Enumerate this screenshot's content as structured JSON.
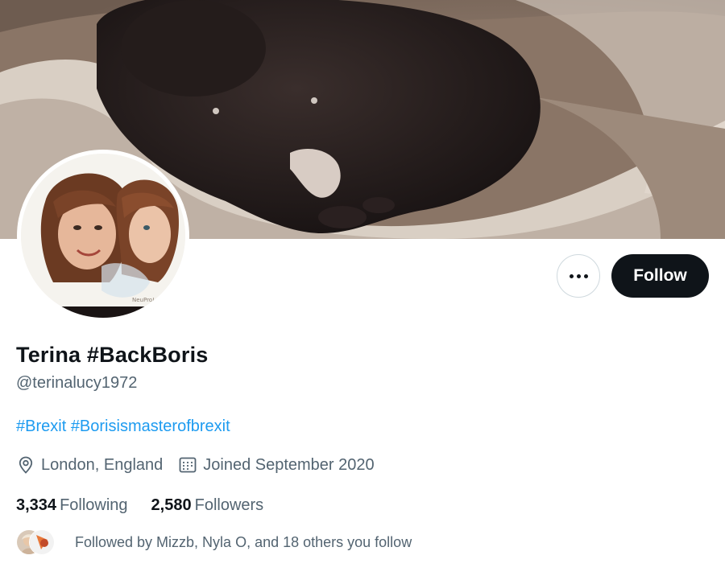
{
  "banner": {
    "icon": "banner-photo-dark-pet-in-basket"
  },
  "avatar": {
    "icon": "profile-photo-two-faces",
    "watermark": "NeuPro!"
  },
  "actions": {
    "more_icon": "more-dots-icon",
    "follow_label": "Follow"
  },
  "profile": {
    "display_name": "Terina #BackBoris",
    "handle": "@terinalucy1972",
    "bio_hashtags": [
      "#Brexit",
      "#Borisismasterofbrexit"
    ],
    "location": "London, England",
    "joined": "Joined September 2020",
    "location_icon": "location-pin-icon",
    "joined_icon": "calendar-icon"
  },
  "stats": {
    "following_count": "3,334",
    "following_label": "Following",
    "followers_count": "2,580",
    "followers_label": "Followers"
  },
  "followed_by": {
    "text": "Followed by Mizzb, Nyla O, and 18 others you follow"
  },
  "colors": {
    "link": "#1d9bf0",
    "text_primary": "#0f1419",
    "text_secondary": "#536471",
    "button_dark": "#0f1419"
  }
}
